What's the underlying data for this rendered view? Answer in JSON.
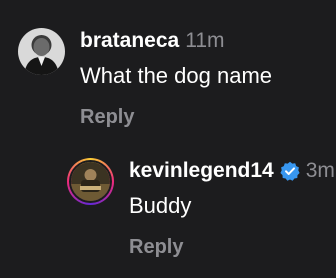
{
  "comments": [
    {
      "username": "brataneca",
      "time": "11m",
      "text": "What the dog name",
      "reply_label": "Reply",
      "avatar": "person-avatar"
    },
    {
      "username": "kevinlegend14",
      "time": "3m",
      "verified": true,
      "text": "Buddy",
      "reply_label": "Reply",
      "avatar": "story-ring-avatar"
    }
  ],
  "colors": {
    "background": "#1c1c1e",
    "secondary_text": "#8e8e93",
    "verified": "#3897f0"
  }
}
